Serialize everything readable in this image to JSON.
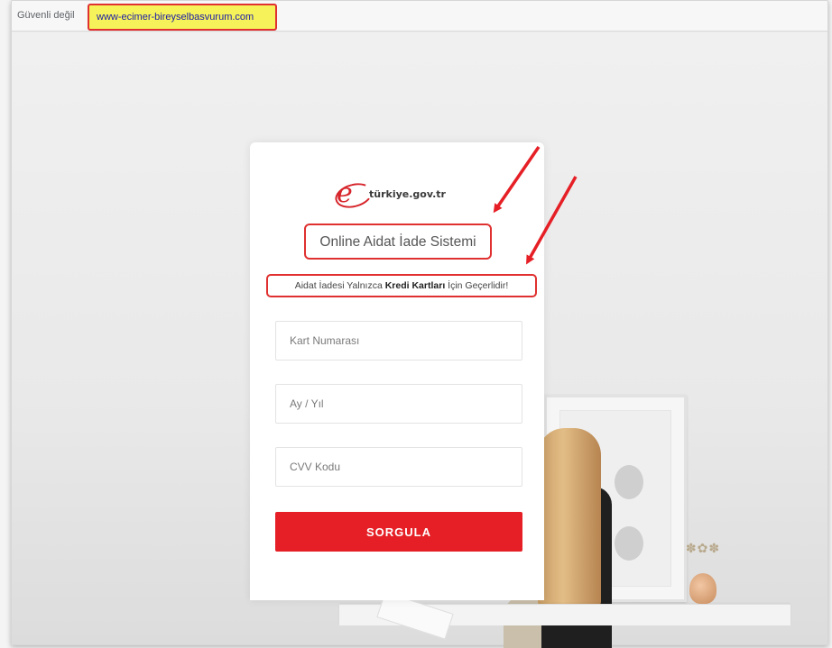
{
  "browser": {
    "security_label": "Güvenli değil",
    "url": "www-ecimer-bireyselbasvurum.com"
  },
  "logo": {
    "text": "türkiye.gov.tr",
    "icon": "e-icon"
  },
  "form": {
    "title": "Online Aidat İade Sistemi",
    "notice_prefix": "Aidat İadesi Yalnızca ",
    "notice_bold": "Kredi Kartları",
    "notice_suffix": " İçin Geçerlidir!",
    "card_number_placeholder": "Kart Numarası",
    "expiry_placeholder": "Ay / Yıl",
    "cvv_placeholder": "CVV Kodu",
    "submit_label": "SORGULA"
  },
  "colors": {
    "accent_red": "#e51f25",
    "annotation_red": "#e03030",
    "url_highlight": "#f6f35a"
  }
}
